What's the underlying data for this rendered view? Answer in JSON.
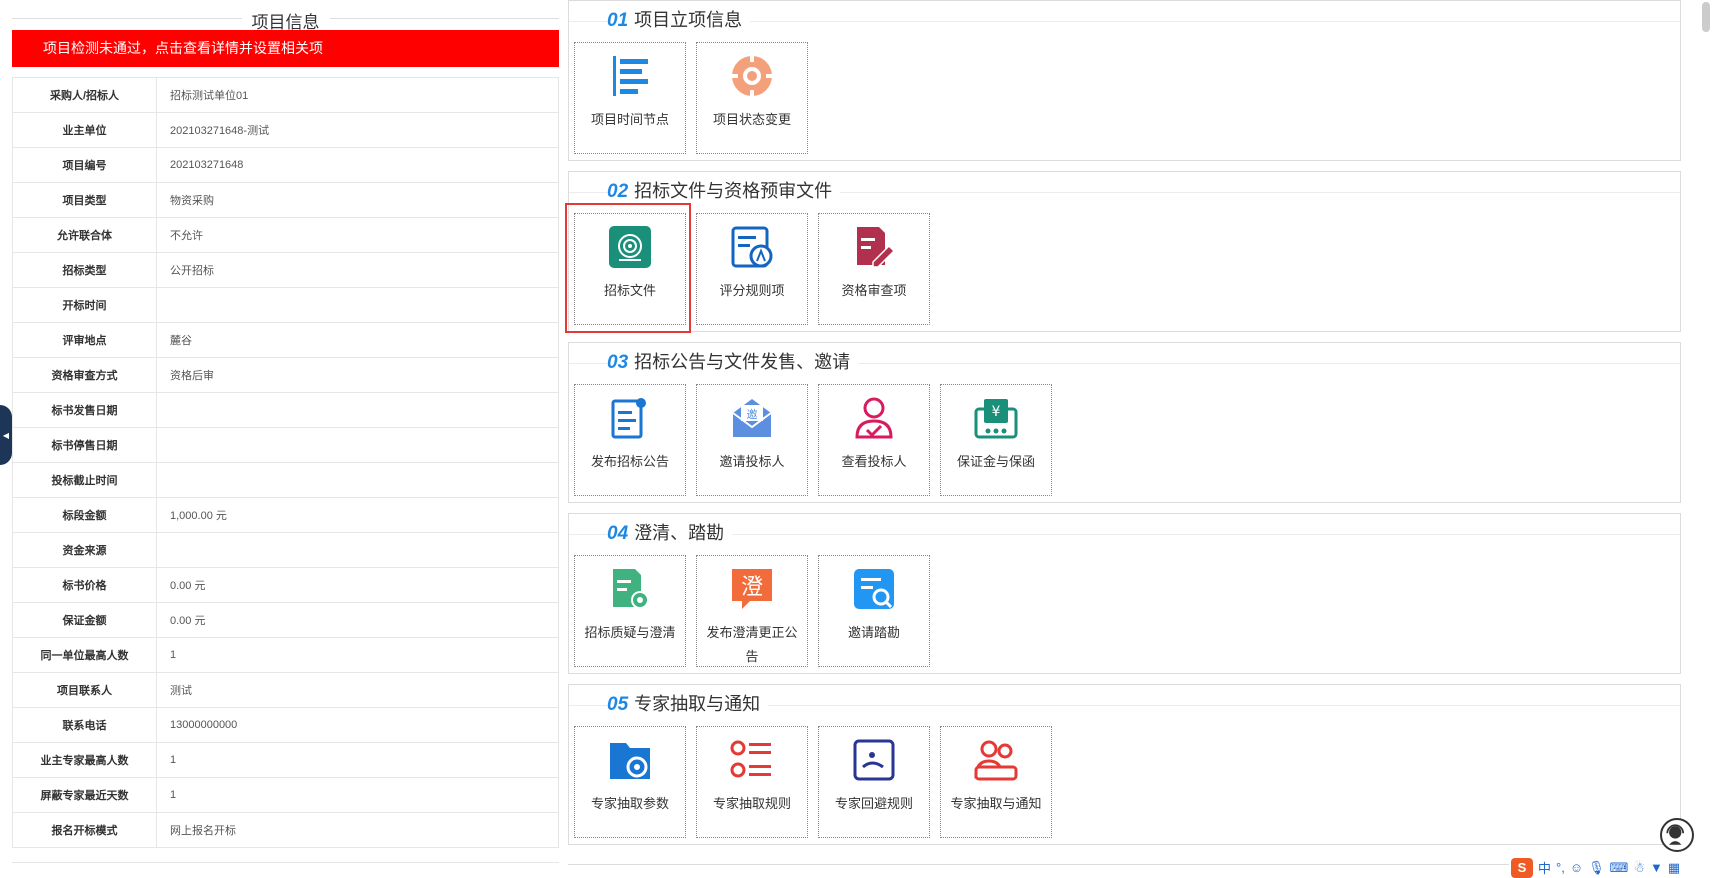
{
  "left_panel": {
    "title": "项目信息",
    "alert_text": "项目检测未通过，点击查看详情并设置相关项",
    "rows": [
      {
        "key": "采购人/招标人",
        "value": "招标测试单位01"
      },
      {
        "key": "业主单位",
        "value": "202103271648-测试"
      },
      {
        "key": "项目编号",
        "value": "202103271648"
      },
      {
        "key": "项目类型",
        "value": "物资采购"
      },
      {
        "key": "允许联合体",
        "value": "不允许"
      },
      {
        "key": "招标类型",
        "value": "公开招标"
      },
      {
        "key": "开标时间",
        "value": ""
      },
      {
        "key": "评审地点",
        "value": "麓谷"
      },
      {
        "key": "资格审查方式",
        "value": "资格后审"
      },
      {
        "key": "标书发售日期",
        "value": ""
      },
      {
        "key": "标书停售日期",
        "value": ""
      },
      {
        "key": "投标截止时间",
        "value": ""
      },
      {
        "key": "标段金额",
        "value": "1,000.00 元"
      },
      {
        "key": "资金来源",
        "value": ""
      },
      {
        "key": "标书价格",
        "value": "0.00 元"
      },
      {
        "key": "保证金额",
        "value": "0.00 元"
      },
      {
        "key": "同一单位最高人数",
        "value": "1"
      },
      {
        "key": "项目联系人",
        "value": "测试"
      },
      {
        "key": "联系电话",
        "value": "13000000000"
      },
      {
        "key": "业主专家最高人数",
        "value": "1"
      },
      {
        "key": "屏蔽专家最近天数",
        "value": "1"
      },
      {
        "key": "报名开标模式",
        "value": "网上报名开标"
      }
    ]
  },
  "sections": [
    {
      "num": "01",
      "title": "项目立项信息",
      "tiles": [
        {
          "label": "项目时间节点",
          "icon": "timeline-icon"
        },
        {
          "label": "项目状态变更",
          "icon": "status-change-icon"
        }
      ]
    },
    {
      "num": "02",
      "title": "招标文件与资格预审文件",
      "tiles": [
        {
          "label": "招标文件",
          "icon": "target-icon"
        },
        {
          "label": "评分规则项",
          "icon": "scoring-rules-icon"
        },
        {
          "label": "资格审查项",
          "icon": "qualification-edit-icon"
        }
      ]
    },
    {
      "num": "03",
      "title": "招标公告与文件发售、邀请",
      "tiles": [
        {
          "label": "发布招标公告",
          "icon": "publish-notice-icon"
        },
        {
          "label": "邀请投标人",
          "icon": "invite-mail-icon"
        },
        {
          "label": "查看投标人",
          "icon": "bidder-user-icon"
        },
        {
          "label": "保证金与保函",
          "icon": "deposit-yen-icon"
        }
      ]
    },
    {
      "num": "04",
      "title": "澄清、踏勘",
      "tiles": [
        {
          "label": "招标质疑与澄清",
          "icon": "doc-gear-icon"
        },
        {
          "label": "发布澄清更正公告",
          "icon": "clarify-chat-icon"
        },
        {
          "label": "邀请踏勘",
          "icon": "survey-search-icon"
        }
      ]
    },
    {
      "num": "05",
      "title": "专家抽取与通知",
      "tiles": [
        {
          "label": "专家抽取参数",
          "icon": "folder-gear-icon"
        },
        {
          "label": "专家抽取规则",
          "icon": "list-rules-icon"
        },
        {
          "label": "专家回避规则",
          "icon": "avoid-rule-icon"
        },
        {
          "label": "专家抽取与通知",
          "icon": "experts-group-icon"
        }
      ]
    }
  ],
  "ime": {
    "brand": "S",
    "mode": "中",
    "punct": "°,"
  },
  "colors": {
    "alert": "#ff0000",
    "accent": "#1e88e5",
    "highlight": "#e53935"
  }
}
